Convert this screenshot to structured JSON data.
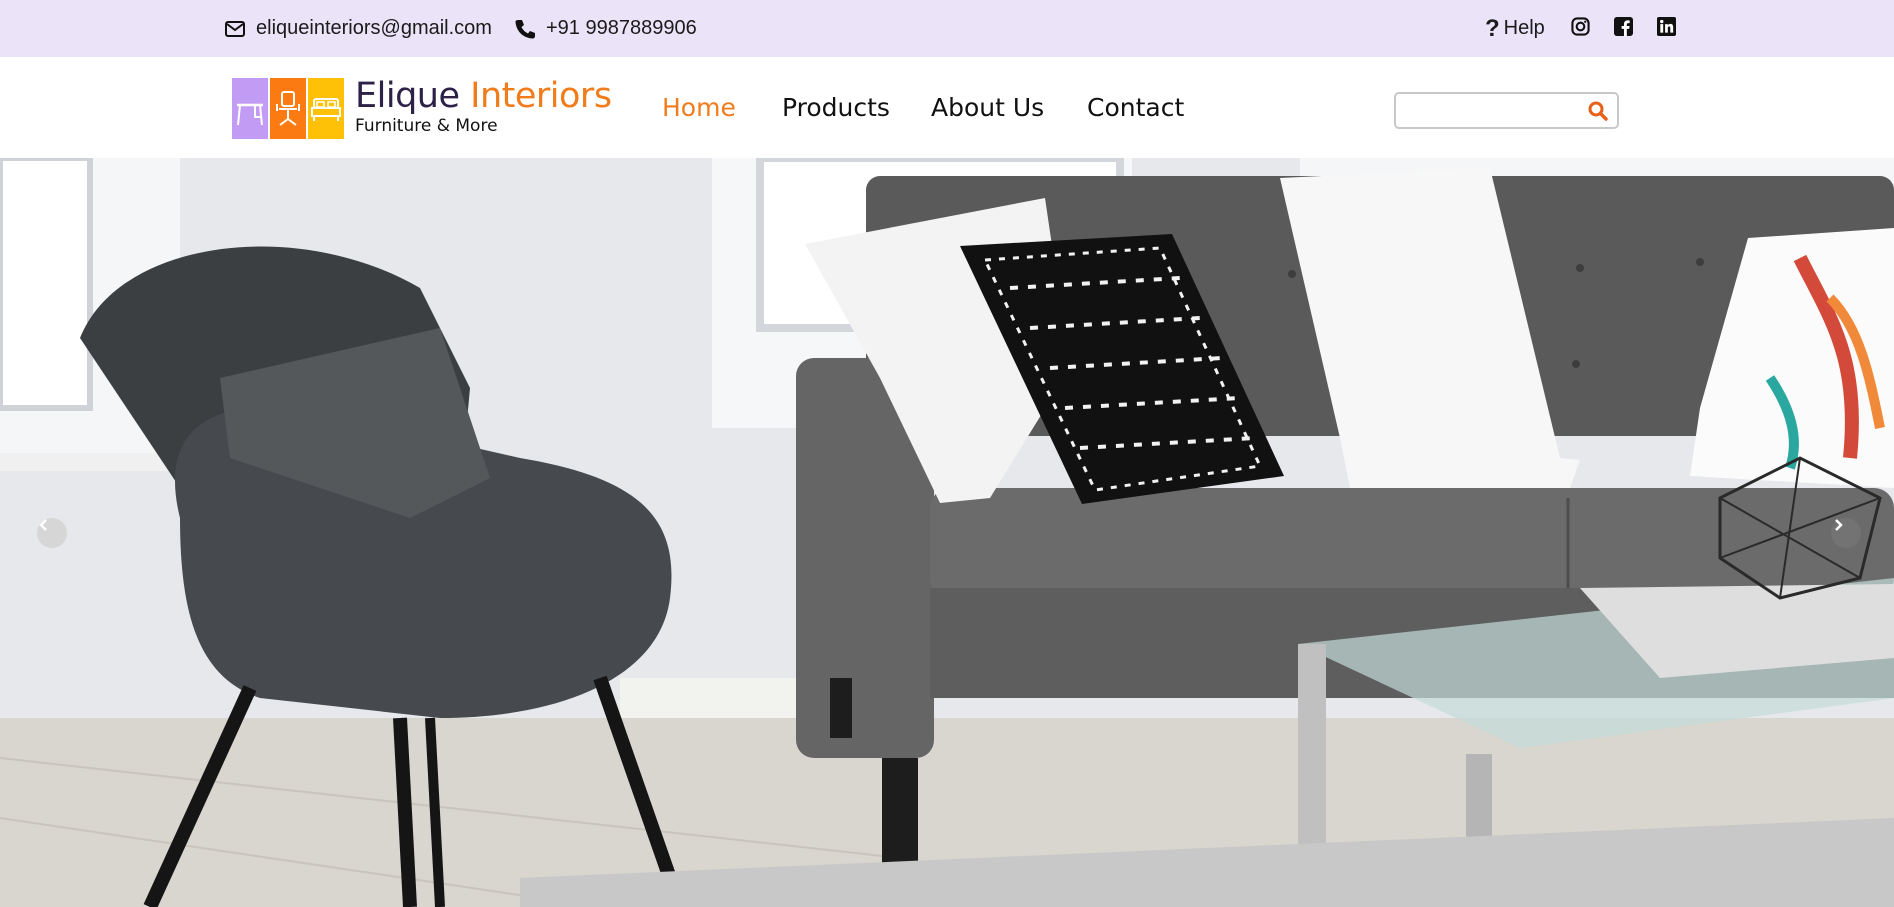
{
  "topbar": {
    "email": "eliqueinteriors@gmail.com",
    "phone": "+91 9987889906",
    "help_label": "Help",
    "social": [
      "instagram-icon",
      "facebook-icon",
      "linkedin-icon"
    ]
  },
  "brand": {
    "name_part1": "Elique",
    "name_part2": "Interiors",
    "tagline": "Furniture & More",
    "colors": {
      "purple": "#c29bf4",
      "orange": "#fb7a11",
      "yellow": "#ffc107",
      "accent": "#f07c1b",
      "dark": "#2e2148"
    }
  },
  "nav": {
    "items": [
      {
        "label": "Home",
        "active": true
      },
      {
        "label": "Products",
        "active": false
      },
      {
        "label": "About Us",
        "active": false
      },
      {
        "label": "Contact",
        "active": false
      }
    ]
  },
  "search": {
    "placeholder": "",
    "value": "",
    "icon": "search-icon"
  },
  "hero": {
    "slide_description_icons": [
      "chevron-left-icon",
      "chevron-right-icon"
    ]
  }
}
